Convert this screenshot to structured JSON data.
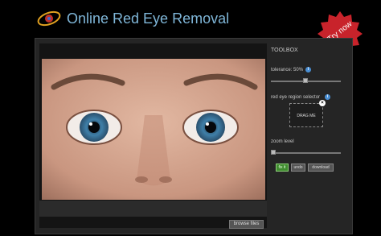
{
  "header": {
    "title": "Online Red Eye Removal",
    "logo_icon": "orbit-logo-icon"
  },
  "badge": {
    "label": "Try now",
    "color": "#c8232b"
  },
  "toolbox": {
    "title": "TOOLBOX",
    "tolerance_label": "tolerance: 50%",
    "tolerance_value": 50,
    "selector_label": "red eye region selector",
    "drag_label": "DRAG ME",
    "zoom_label": "zoom level",
    "zoom_value": 0
  },
  "buttons": {
    "fix": "fix it",
    "undo": "undo",
    "download": "download",
    "browse": "browse files"
  },
  "colors": {
    "title": "#7fb6d8",
    "accent_green": "#3f8b2f",
    "info_blue": "#4a8fd4",
    "background": "#000000"
  }
}
